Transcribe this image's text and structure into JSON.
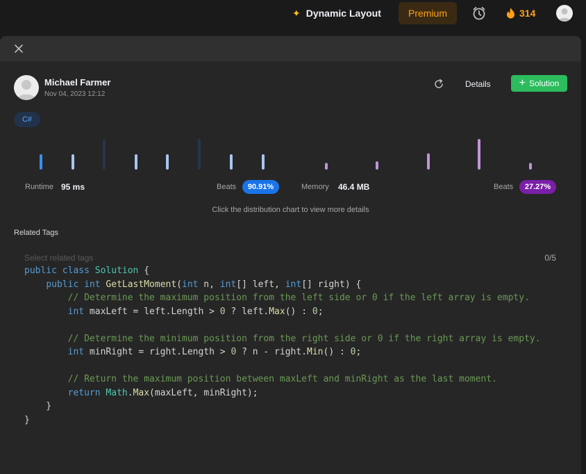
{
  "topbar": {
    "dynamic_layout": "Dynamic Layout",
    "premium": "Premium",
    "streak_count": "314"
  },
  "submission": {
    "author": "Michael Farmer",
    "date": "Nov 04, 2023 12:12",
    "details": "Details",
    "solution": "Solution",
    "language": "C#"
  },
  "stats": {
    "runtime_label": "Runtime",
    "runtime_value": "95 ms",
    "runtime_beats_label": "Beats",
    "runtime_beats": "90.91%",
    "memory_label": "Memory",
    "memory_value": "46.4 MB",
    "memory_beats_label": "Beats",
    "memory_beats": "27.27%",
    "hint": "Click the distribution chart to view more details"
  },
  "chart_data": [
    {
      "type": "bar",
      "series": [
        {
          "values": [
            0.5,
            0.5,
            1.0,
            0.5,
            0.5,
            1.0,
            0.5,
            0.5
          ],
          "highlight_index": 0,
          "color": "#3a8ff0"
        }
      ]
    },
    {
      "type": "bar",
      "series": [
        {
          "values": [
            0.22,
            0.27,
            0.53,
            1.0,
            0.22
          ],
          "highlight_index": 3,
          "color": "#c193d9"
        }
      ]
    }
  ],
  "tags": {
    "title": "Related Tags",
    "placeholder": "Select related tags",
    "count": "0/5"
  },
  "code": {
    "lines": [
      "public class Solution {",
      "    public int GetLastMoment(int n, int[] left, int[] right) {",
      "        // Determine the maximum position from the left side or 0 if the left array is empty.",
      "        int maxLeft = left.Length > 0 ? left.Max() : 0;",
      "",
      "        // Determine the minimum position from the right side or 0 if the right array is empty.",
      "        int minRight = right.Length > 0 ? n - right.Min() : 0;",
      "",
      "        // Return the maximum position between maxLeft and minRight as the last moment.",
      "        return Math.Max(maxLeft, minRight);",
      "    }",
      "}"
    ]
  }
}
